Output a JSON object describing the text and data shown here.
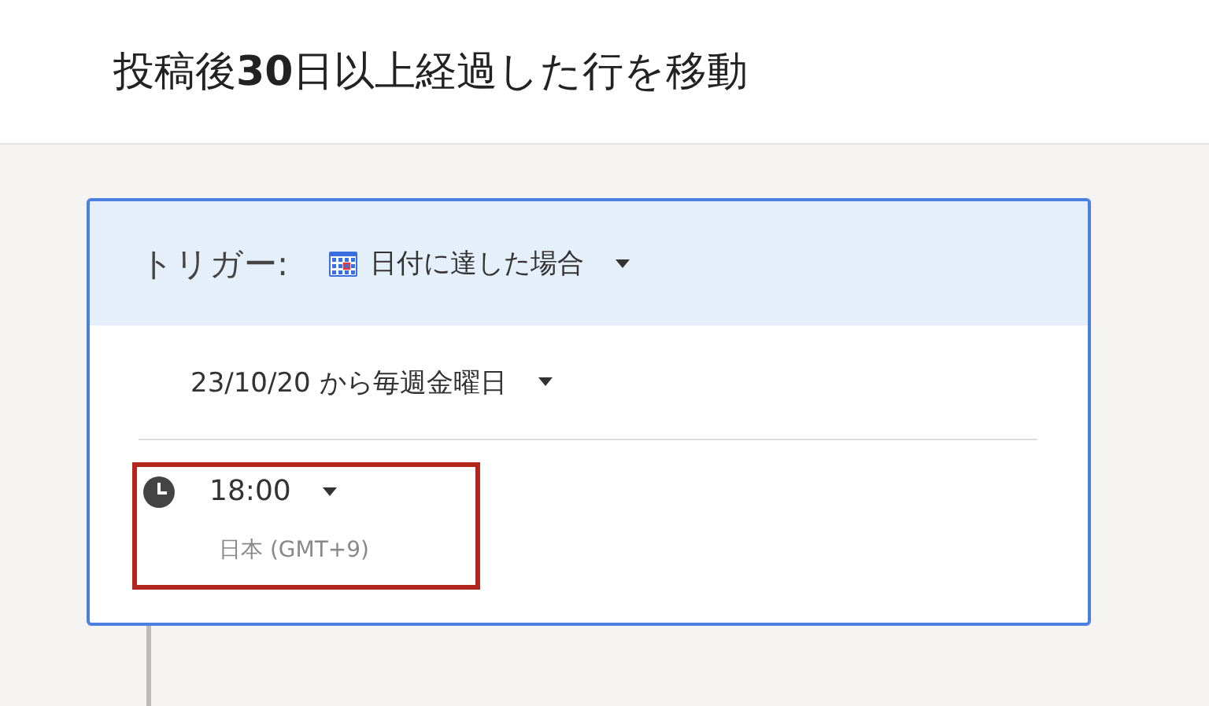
{
  "title": "投稿後**30**日以上経過した行を移動",
  "trigger": {
    "label": "トリガー:",
    "type": "日付に達した場合"
  },
  "schedule": {
    "value": "23/10/20 から毎週金曜日"
  },
  "time": {
    "value": "18:00",
    "timezone": "日本 (GMT+9)",
    "highlighted": true
  }
}
